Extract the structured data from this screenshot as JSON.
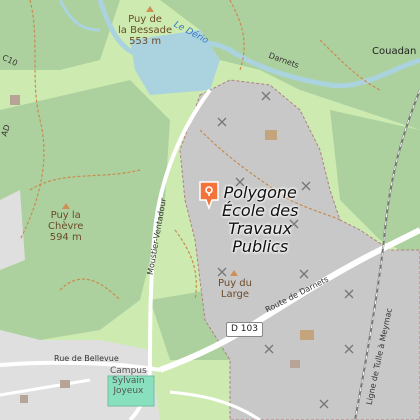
{
  "map": {
    "poi_marker": {
      "icon": "map-pin-icon",
      "color": "#f4733a"
    },
    "poi_title": {
      "line1": "Polygone",
      "line2": "École des",
      "line3": "Travaux",
      "line4": "Publics"
    },
    "peaks": [
      {
        "name": "Puy de la Bessade",
        "line1": "Puy de",
        "line2": "la Bessade",
        "elevation": "553 m"
      },
      {
        "name": "Puy la Chèvre",
        "line1": "Puy la",
        "line2": "Chèvre",
        "elevation": "594 m"
      },
      {
        "name": "Puy du Large",
        "line1": "Puy du",
        "line2": "Large",
        "elevation": ""
      }
    ],
    "rivers": {
      "derio": "Le Dério"
    },
    "streets": {
      "darnets_top": "Darnets",
      "route_darnets": "Route de Darnets",
      "moustier": "Moustier-Ventadour",
      "bellevue": "Rue de Bellevue",
      "tulle_meymac": "Ligne de Tulle à Meymac",
      "c10": "C10",
      "ad": "AD"
    },
    "shields": {
      "d103": "D 103"
    },
    "places": {
      "couadan": "Couadan"
    },
    "campus": {
      "line1": "Campus",
      "line2": "Sylvain",
      "line3": "Joyeux"
    },
    "colors": {
      "forest": "#add19e",
      "meadow": "#cdebb0",
      "military": "#c8c8c8",
      "water": "#aad3df",
      "road": "#ffffff",
      "path": "#c98b4f"
    }
  }
}
